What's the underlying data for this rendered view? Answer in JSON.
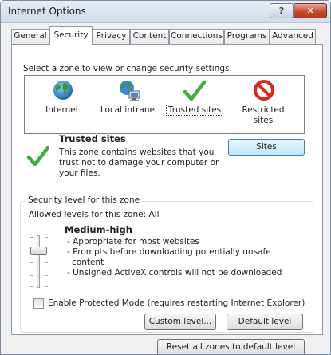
{
  "window": {
    "title": "Internet Options",
    "help_glyph": "?",
    "close_glyph": "✕"
  },
  "tabs": [
    {
      "label": "General"
    },
    {
      "label": "Security"
    },
    {
      "label": "Privacy"
    },
    {
      "label": "Content"
    },
    {
      "label": "Connections"
    },
    {
      "label": "Programs"
    },
    {
      "label": "Advanced"
    }
  ],
  "active_tab": "Security",
  "security": {
    "prompt": "Select a zone to view or change security settings.",
    "zones": [
      {
        "label": "Internet",
        "icon": "globe-icon"
      },
      {
        "label": "Local intranet",
        "icon": "network-icon"
      },
      {
        "label": "Trusted sites",
        "icon": "checkmark-icon",
        "selected": true
      },
      {
        "label_line1": "Restricted",
        "label_line2": "sites",
        "icon": "prohibited-icon"
      }
    ],
    "zone_info": {
      "title": "Trusted sites",
      "description_lines": [
        "This zone contains websites that you",
        "trust not to damage your computer or",
        "your files."
      ]
    },
    "sites_button": "Sites",
    "level_group": {
      "title": "Security level for this zone",
      "allowed": "Allowed levels for this zone: All",
      "level_name": "Medium-high",
      "bullets": [
        "- Appropriate for most websites",
        "- Prompts before downloading potentially unsafe",
        "content",
        "- Unsigned ActiveX controls will not be downloaded"
      ],
      "protected_mode": {
        "label": "Enable Protected Mode (requires restarting Internet Explorer)",
        "checked": false
      },
      "custom_level_button": "Custom level...",
      "default_level_button": "Default level"
    },
    "reset_button": "Reset all zones to default level"
  },
  "colors": {
    "trusted_check": "#3fae3a",
    "restricted_red": "#d9281c",
    "globe_blue": "#2a7fd0",
    "globe_green": "#3a9a3a",
    "focused_button_border": "#3c7fb1"
  }
}
